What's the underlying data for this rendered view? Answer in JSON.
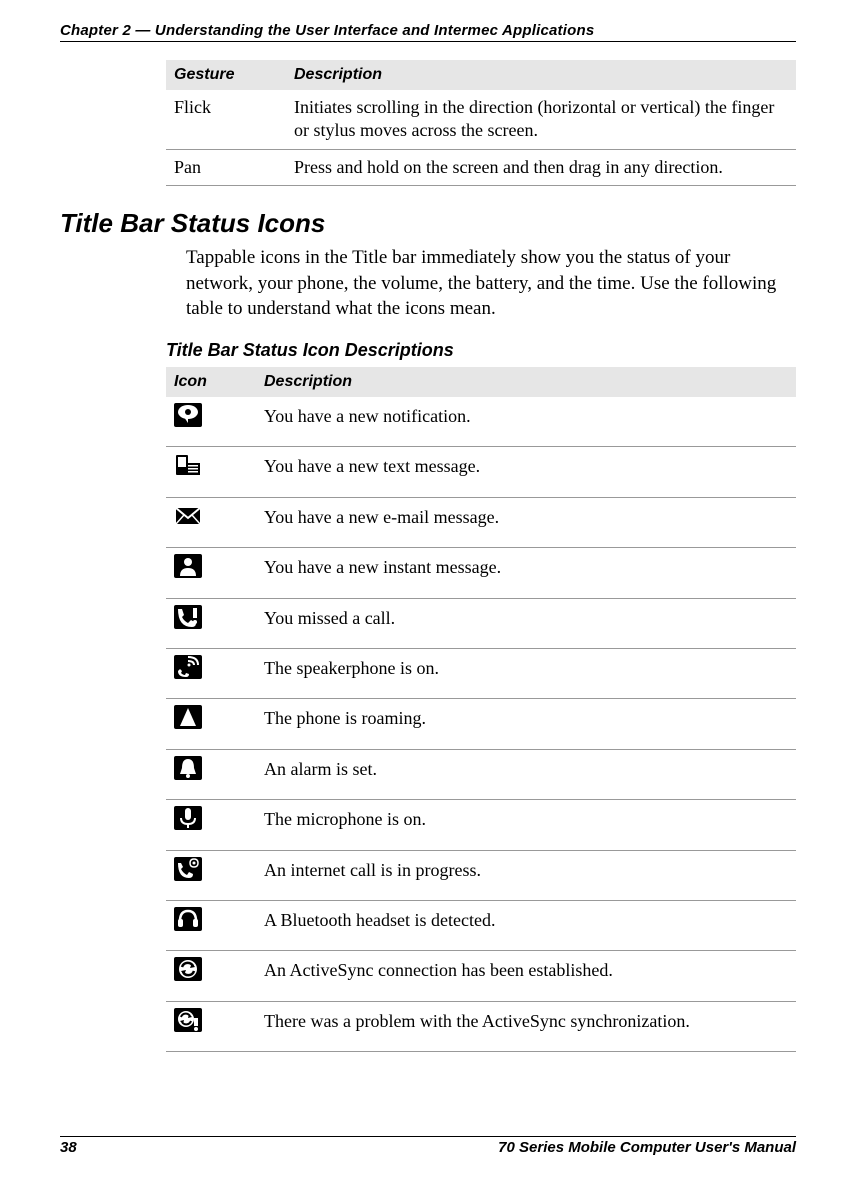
{
  "chapter_header": "Chapter 2 — Understanding the User Interface and Intermec Applications",
  "gesture_table": {
    "headers": {
      "col1": "Gesture",
      "col2": "Description"
    },
    "rows": [
      {
        "gesture": "Flick",
        "desc": "Initiates scrolling in the direction (horizontal or vertical) the finger or stylus moves across the screen."
      },
      {
        "gesture": "Pan",
        "desc": "Press and hold on the screen and then drag in any direction."
      }
    ]
  },
  "section_title": "Title Bar Status Icons",
  "section_body": "Tappable icons in the Title bar immediately show you the status of your network, your phone, the volume, the battery, and the time. Use the following table to understand what the icons mean.",
  "subsection_title": "Title Bar Status Icon Descriptions",
  "icon_table": {
    "headers": {
      "col1": "Icon",
      "col2": "Description"
    },
    "rows": [
      {
        "icon": "notification-icon",
        "desc": "You have a new notification."
      },
      {
        "icon": "text-message-icon",
        "desc": "You have a new text message."
      },
      {
        "icon": "email-icon",
        "desc": "You have a new e-mail message."
      },
      {
        "icon": "instant-message-icon",
        "desc": "You have a new instant message."
      },
      {
        "icon": "missed-call-icon",
        "desc": "You missed a call."
      },
      {
        "icon": "speakerphone-icon",
        "desc": "The speakerphone is on."
      },
      {
        "icon": "roaming-icon",
        "desc": "The phone is roaming."
      },
      {
        "icon": "alarm-icon",
        "desc": "An alarm is set."
      },
      {
        "icon": "microphone-icon",
        "desc": "The microphone is on."
      },
      {
        "icon": "internet-call-icon",
        "desc": "An internet call is in progress."
      },
      {
        "icon": "bluetooth-headset-icon",
        "desc": "A Bluetooth headset is detected."
      },
      {
        "icon": "activesync-icon",
        "desc": "An ActiveSync connection has been established."
      },
      {
        "icon": "activesync-error-icon",
        "desc": "There was a problem with the ActiveSync synchronization."
      }
    ]
  },
  "footer": {
    "page_number": "38",
    "manual_title": "70 Series Mobile Computer User's Manual"
  }
}
